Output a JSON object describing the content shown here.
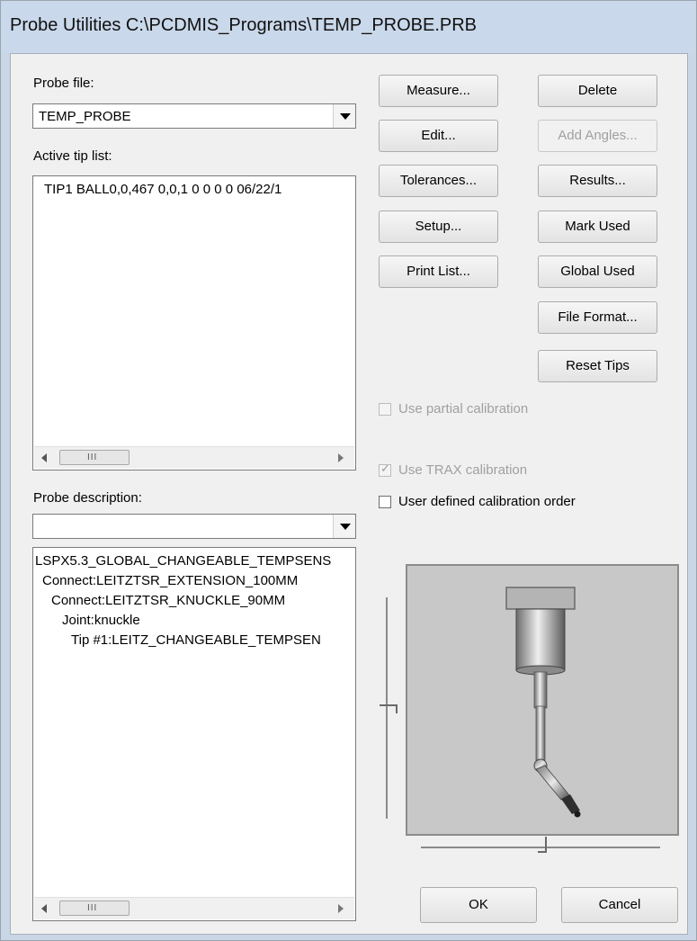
{
  "window": {
    "title": "Probe Utilities  C:\\PCDMIS_Programs\\TEMP_PROBE.PRB"
  },
  "probe_file": {
    "label": "Probe file:",
    "value": "TEMP_PROBE"
  },
  "active_tip_list": {
    "label": "Active tip list:",
    "rows": [
      "TIP1 BALL0,0,467  0,0,1  0  0  0  0  06/22/1"
    ]
  },
  "probe_description": {
    "label": "Probe description:",
    "value": "",
    "tree": [
      "LSPX5.3_GLOBAL_CHANGEABLE_TEMPSENS",
      "Connect:LEITZTSR_EXTENSION_100MM",
      "Connect:LEITZTSR_KNUCKLE_90MM",
      "Joint:knuckle",
      "Tip #1:LEITZ_CHANGEABLE_TEMPSEN"
    ]
  },
  "buttons": {
    "measure": "Measure...",
    "delete": "Delete",
    "edit": "Edit...",
    "add_angles": "Add Angles...",
    "tolerances": "Tolerances...",
    "results": "Results...",
    "setup": "Setup...",
    "mark_used": "Mark Used",
    "print_list": "Print List...",
    "global_used": "Global Used",
    "file_format": "File Format...",
    "reset_tips": "Reset Tips",
    "ok": "OK",
    "cancel": "Cancel"
  },
  "checkboxes": {
    "partial_calibration": {
      "label": "Use partial calibration",
      "checked": false,
      "enabled": false
    },
    "trax_calibration": {
      "label": "Use TRAX calibration",
      "checked": true,
      "enabled": false
    },
    "user_defined_order": {
      "label": "User defined calibration order",
      "checked": false,
      "enabled": true
    }
  },
  "scroll_grip": "III",
  "colors": {
    "titlebar": "#c9d8ea",
    "dialog": "#f0f0f0",
    "preview_bg": "#c8c8c8",
    "probe_metal": "#9a9a9a"
  }
}
